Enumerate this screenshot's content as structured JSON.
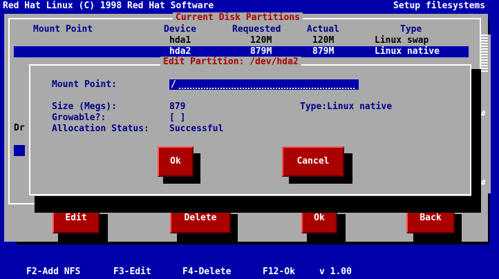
{
  "header": {
    "left": "Red Hat Linux (C) 1998 Red Hat Software",
    "right": "Setup filesystems"
  },
  "main_window": {
    "title": "Current Disk Partitions",
    "columns": [
      "Mount Point",
      "Device",
      "Requested",
      "Actual",
      "Type"
    ],
    "rows": [
      {
        "mount": "",
        "device": "hda1",
        "requested": "120M",
        "actual": "120M",
        "type": "Linux swap"
      },
      {
        "mount": "",
        "device": "hda2",
        "requested": "879M",
        "actual": "879M",
        "type": "Linux native"
      }
    ],
    "drive_label": "Dr",
    "buttons": {
      "edit": "Edit",
      "delete": "Delete",
      "ok": "Ok",
      "back": "Back"
    },
    "scrollbar_marks": [
      "#",
      "#"
    ]
  },
  "dialog": {
    "title": "Edit Partition: /dev/hda2",
    "mount_point_label": "Mount Point:",
    "mount_point_value": "/",
    "size_label": "Size (Megs):",
    "size_value": "879",
    "type_text": "Type:Linux native",
    "growable_label": "Growable?:",
    "growable_value": "[ ]",
    "alloc_label": "Allocation Status:",
    "alloc_value": "Successful",
    "ok_label": "Ok",
    "cancel_label": "Cancel"
  },
  "footer": {
    "keys": [
      "F2-Add NFS",
      "F3-Edit",
      "F4-Delete",
      "F12-Ok",
      "v 1.00"
    ]
  },
  "colors": {
    "background": "#0000aa",
    "window": "#aaaaaa",
    "button": "#aa0000",
    "selected_row": "#0000aa"
  }
}
